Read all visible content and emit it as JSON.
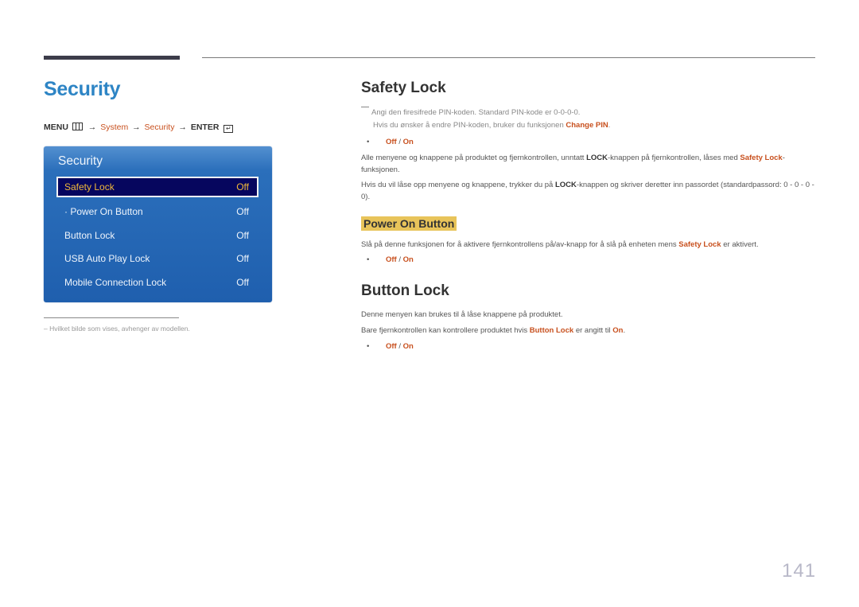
{
  "page": {
    "title": "Security",
    "page_number": "141"
  },
  "breadcrumb": {
    "menu": "MENU",
    "menu_icon": "menu-icon",
    "arrow": "→",
    "system": "System",
    "security": "Security",
    "enter": "ENTER",
    "enter_icon": "enter-icon",
    "enter_glyph": "↵"
  },
  "osd": {
    "title": "Security",
    "items": [
      {
        "label": "Safety Lock",
        "value": "Off",
        "selected": true
      },
      {
        "label": "· Power On Button",
        "value": "Off"
      },
      {
        "label": "Button Lock",
        "value": "Off"
      },
      {
        "label": "USB Auto Play Lock",
        "value": "Off"
      },
      {
        "label": "Mobile Connection Lock",
        "value": "Off"
      }
    ]
  },
  "footnote": "–  Hvilket bilde som vises, avhenger av modellen.",
  "sections": {
    "safety_lock": {
      "heading": "Safety Lock",
      "note_line1": "Angi den firesifrede PIN-koden. Standard PIN-kode er 0-0-0-0.",
      "note_line2_pre": "Hvis du ønsker å endre PIN-koden, bruker du funksjonen ",
      "note_line2_hl": "Change PIN",
      "note_line2_post": ".",
      "option_off": "Off",
      "option_sep": " / ",
      "option_on": "On",
      "para1_a": "Alle menyene og knappene på produktet og fjernkontrollen, unntatt ",
      "para1_b": "LOCK",
      "para1_c": "-knappen på fjernkontrollen, låses med ",
      "para1_d": "Safety Lock",
      "para1_e": "-funksjonen.",
      "para2_a": "Hvis du vil låse opp menyene og knappene, trykker du på ",
      "para2_b": "LOCK",
      "para2_c": "-knappen og skriver deretter inn passordet (standardpassord: 0 - 0 - 0 - 0)."
    },
    "power_on_button": {
      "heading": "Power On Button",
      "para_a": "Slå på denne funksjonen for å aktivere fjernkontrollens på/av-knapp for å slå på enheten mens ",
      "para_b": "Safety Lock",
      "para_c": " er aktivert.",
      "option_off": "Off",
      "option_sep": " / ",
      "option_on": "On"
    },
    "button_lock": {
      "heading": "Button Lock",
      "para1": "Denne menyen kan brukes til å låse knappene på produktet.",
      "para2_a": "Bare fjernkontrollen kan kontrollere produktet hvis ",
      "para2_b": "Button Lock",
      "para2_c": " er angitt til ",
      "para2_d": "On",
      "para2_e": ".",
      "option_off": "Off",
      "option_sep": " / ",
      "option_on": "On"
    }
  },
  "colors": {
    "title_blue": "#2e85c5",
    "highlight_orange": "#c8501e",
    "osd_blue": "#1f5fae",
    "osd_selected_bg": "#06065e",
    "osd_selected_text": "#f0b83a",
    "heading_highlight": "#e8c45a"
  }
}
